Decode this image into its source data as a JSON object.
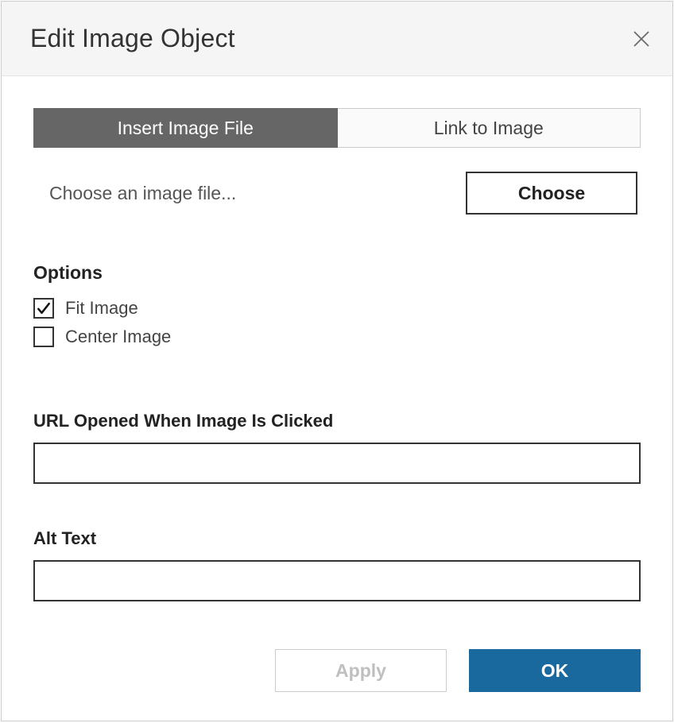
{
  "title": "Edit Image Object",
  "tabs": {
    "insert": "Insert Image File",
    "link": "Link to Image"
  },
  "file_row": {
    "label": "Choose an image file...",
    "choose_button": "Choose"
  },
  "options": {
    "heading": "Options",
    "fit": {
      "label": "Fit Image",
      "checked": true
    },
    "center": {
      "label": "Center Image",
      "checked": false
    }
  },
  "url_field": {
    "label": "URL Opened When Image Is Clicked",
    "value": ""
  },
  "alt_field": {
    "label": "Alt Text",
    "value": ""
  },
  "buttons": {
    "apply": "Apply",
    "ok": "OK"
  }
}
